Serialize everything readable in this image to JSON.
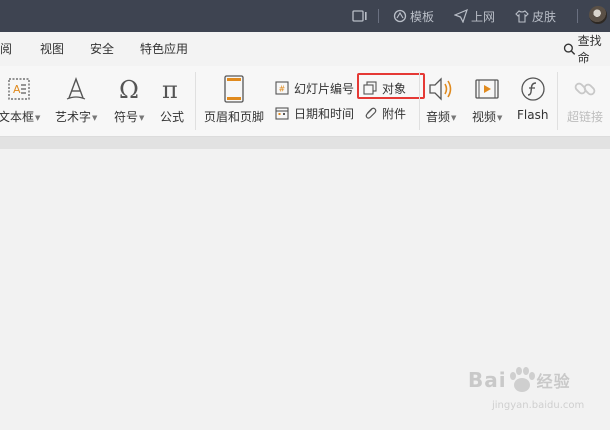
{
  "titlebar": {
    "items": [
      {
        "label": "",
        "icon": "screen-record-icon"
      },
      {
        "label": "模板",
        "icon": "template-icon"
      },
      {
        "label": "上网",
        "icon": "send-icon"
      },
      {
        "label": "皮肤",
        "icon": "shirt-icon"
      }
    ]
  },
  "menu": {
    "items": [
      "阅",
      "视图",
      "安全",
      "特色应用"
    ],
    "search_label": "查找命"
  },
  "ribbon": {
    "textbox": "文本框",
    "arttext": "艺术字",
    "symbol": "符号",
    "formula": "公式",
    "header_footer": "页眉和页脚",
    "slide_number": "幻灯片编号",
    "object": "对象",
    "datetime": "日期和时间",
    "attachment": "附件",
    "audio": "音频",
    "video": "视频",
    "flash": "Flash",
    "hyperlink": "超链接"
  },
  "watermark": {
    "main": "Bai",
    "cn": "经验",
    "sub": "jingyan.baidu.com"
  },
  "colors": {
    "titlebar_bg": "#3e4451",
    "highlight": "#e53935"
  }
}
